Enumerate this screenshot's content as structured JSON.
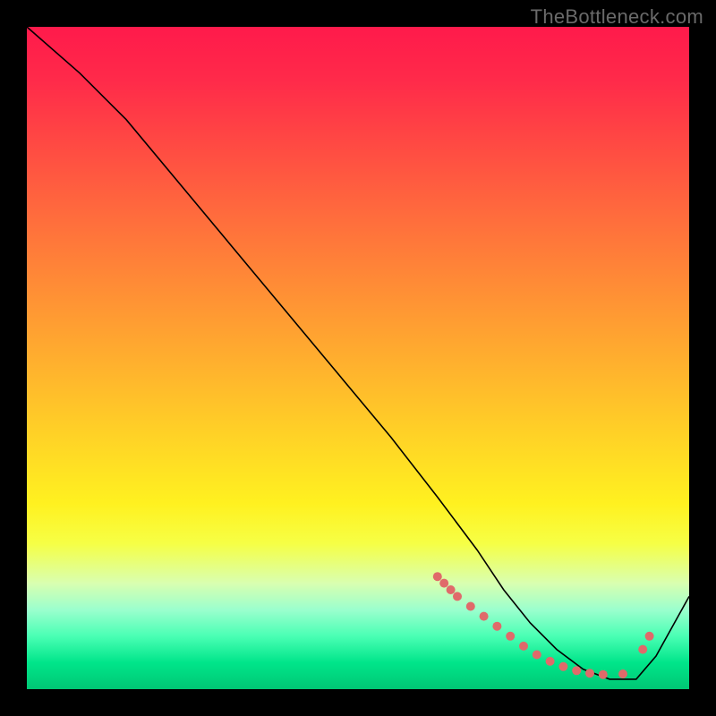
{
  "watermark": "TheBottleneck.com",
  "chart_data": {
    "type": "line",
    "title": "",
    "xlabel": "",
    "ylabel": "",
    "xlim": [
      0,
      100
    ],
    "ylim": [
      0,
      100
    ],
    "background_gradient": {
      "top_color": "#ff1a4b",
      "mid_color": "#ffd326",
      "bottom_color": "#00c774"
    },
    "series": [
      {
        "name": "bottleneck-curve",
        "color": "#000000",
        "x": [
          0,
          8,
          15,
          25,
          35,
          45,
          55,
          62,
          68,
          72,
          76,
          80,
          84,
          88,
          92,
          95,
          100
        ],
        "y": [
          100,
          93,
          86,
          74,
          62,
          50,
          38,
          29,
          21,
          15,
          10,
          6,
          3,
          1.5,
          1.5,
          5,
          14
        ]
      }
    ],
    "markers": {
      "name": "highlight-dots",
      "color": "#e06a6a",
      "x": [
        62,
        63,
        64,
        65,
        67,
        69,
        71,
        73,
        75,
        77,
        79,
        81,
        83,
        85,
        87,
        90,
        93,
        94
      ],
      "y": [
        17,
        16,
        15,
        14,
        12.5,
        11,
        9.5,
        8,
        6.5,
        5.2,
        4.2,
        3.4,
        2.8,
        2.4,
        2.2,
        2.3,
        6,
        8
      ]
    }
  }
}
